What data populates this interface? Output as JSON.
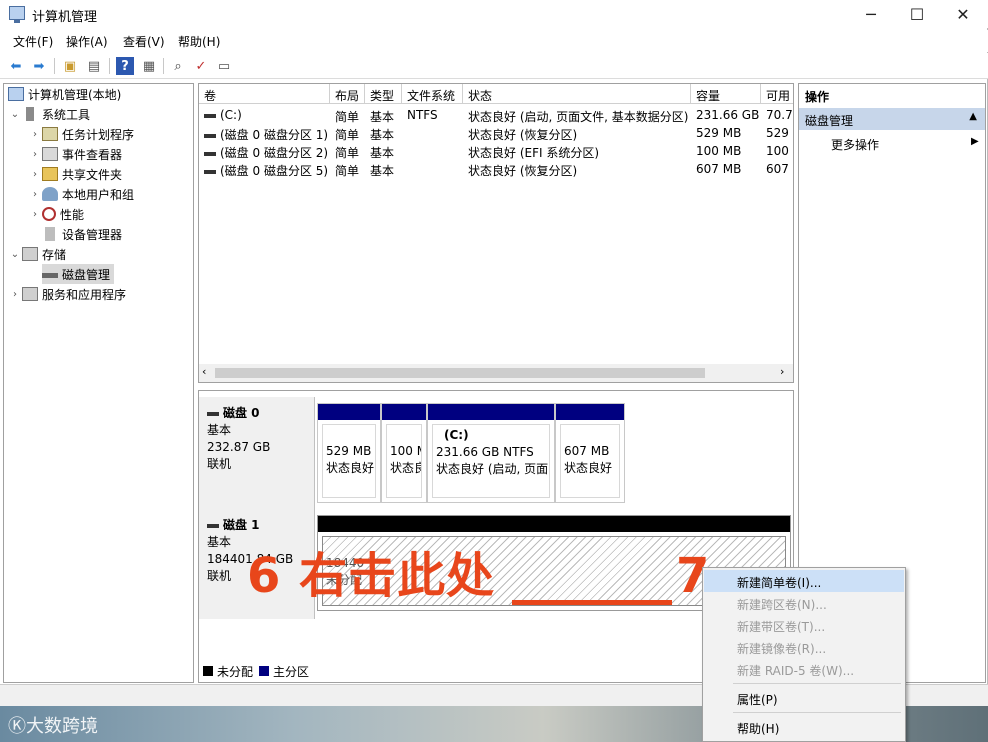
{
  "window": {
    "title": "计算机管理"
  },
  "menu": [
    "文件(F)",
    "操作(A)",
    "查看(V)",
    "帮助(H)"
  ],
  "tree": {
    "root": "计算机管理(本地)",
    "system_tools": "系统工具",
    "task_scheduler": "任务计划程序",
    "event_viewer": "事件查看器",
    "shared_folders": "共享文件夹",
    "local_users": "本地用户和组",
    "performance": "性能",
    "device_manager": "设备管理器",
    "storage": "存储",
    "disk_management": "磁盘管理",
    "services": "服务和应用程序"
  },
  "volumes": {
    "columns": [
      "卷",
      "布局",
      "类型",
      "文件系统",
      "状态",
      "容量",
      "可用"
    ],
    "rows": [
      {
        "name": "(C:)",
        "layout": "简单",
        "type": "基本",
        "fs": "NTFS",
        "status": "状态良好 (启动, 页面文件, 基本数据分区)",
        "cap": "231.66 GB",
        "free": "70.7"
      },
      {
        "name": "(磁盘 0 磁盘分区 1)",
        "layout": "简单",
        "type": "基本",
        "fs": "",
        "status": "状态良好 (恢复分区)",
        "cap": "529 MB",
        "free": "529"
      },
      {
        "name": "(磁盘 0 磁盘分区 2)",
        "layout": "简单",
        "type": "基本",
        "fs": "",
        "status": "状态良好 (EFI 系统分区)",
        "cap": "100 MB",
        "free": "100"
      },
      {
        "name": "(磁盘 0 磁盘分区 5)",
        "layout": "简单",
        "type": "基本",
        "fs": "",
        "status": "状态良好 (恢复分区)",
        "cap": "607 MB",
        "free": "607"
      }
    ]
  },
  "disk0": {
    "name": "磁盘 0",
    "type": "基本",
    "size": "232.87 GB",
    "state": "联机",
    "parts": [
      {
        "label": "",
        "size": "529 MB",
        "status": "状态良好"
      },
      {
        "label": "",
        "size": "100 M",
        "status": "状态良"
      },
      {
        "label": "(C:)",
        "size": "231.66 GB NTFS",
        "status": "状态良好 (启动, 页面"
      },
      {
        "label": "",
        "size": "607 MB",
        "status": "状态良好"
      }
    ]
  },
  "disk1": {
    "name": "磁盘 1",
    "type": "基本",
    "size": "184401.84 GB",
    "state": "联机",
    "part_size": "18440",
    "part_status": "未分配"
  },
  "legend": {
    "unallocated": "未分配",
    "primary": "主分区",
    "colors": {
      "unallocated": "#000000",
      "primary": "#000080"
    }
  },
  "ops": {
    "title": "操作",
    "section": "磁盘管理",
    "more": "更多操作"
  },
  "context_menu": {
    "items": [
      {
        "label": "新建简单卷(I)...",
        "enabled": true
      },
      {
        "label": "新建跨区卷(N)...",
        "enabled": false
      },
      {
        "label": "新建带区卷(T)...",
        "enabled": false
      },
      {
        "label": "新建镜像卷(R)...",
        "enabled": false
      },
      {
        "label": "新建 RAID-5 卷(W)...",
        "enabled": false
      },
      {
        "label": "属性(P)",
        "enabled": true
      },
      {
        "label": "帮助(H)",
        "enabled": true
      }
    ]
  },
  "annotation": {
    "step6": "6 右击此处",
    "step7": "7"
  },
  "watermark": "大数跨境"
}
